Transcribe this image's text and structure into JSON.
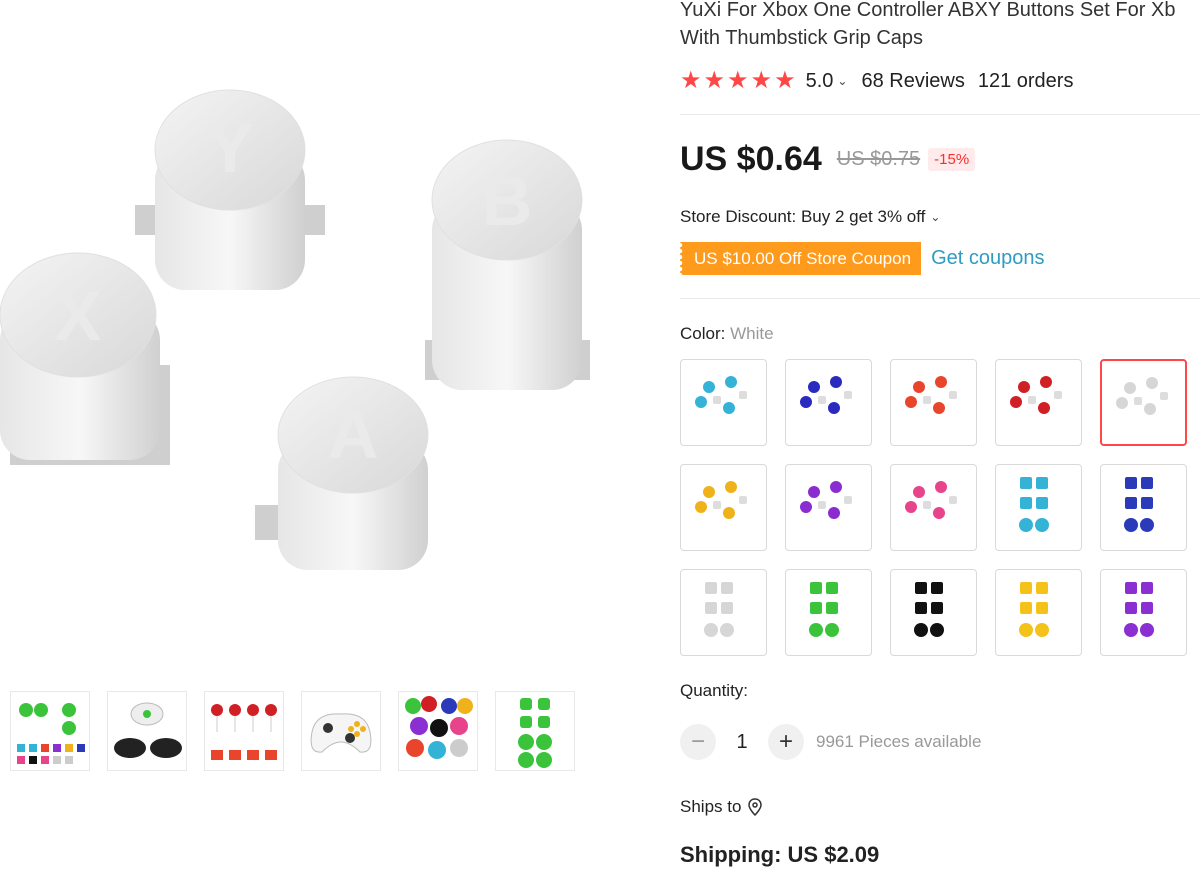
{
  "product": {
    "title_line1": "YuXi For Xbox One Controller ABXY Buttons Set For Xb",
    "title_line2": "With Thumbstick Grip Caps",
    "rating": "5.0",
    "reviews": "68 Reviews",
    "orders": "121 orders",
    "price": "US $0.64",
    "original_price": "US $0.75",
    "discount_badge": "-15%",
    "store_discount": "Store Discount: Buy 2 get 3% off",
    "coupon_label": "US $10.00 Off Store Coupon",
    "get_coupons": "Get coupons",
    "color_label": "Color: ",
    "color_value": "White",
    "quantity_label": "Quantity:",
    "quantity_value": "1",
    "pieces_available": "9961 Pieces available",
    "ships_to": "Ships to",
    "shipping": "Shipping: US $2.09"
  },
  "main_image": {
    "letters": [
      "Y",
      "B",
      "X",
      "A"
    ],
    "color": "#d9d9d9"
  },
  "thumbnails": [
    {
      "name": "multi-color-set"
    },
    {
      "name": "controllers-white-black"
    },
    {
      "name": "red-buttons-labeled"
    },
    {
      "name": "white-controller"
    },
    {
      "name": "colorful-caps-bag"
    },
    {
      "name": "green-set"
    }
  ],
  "swatches": [
    {
      "color": "#34b3d6",
      "layout": "abxy"
    },
    {
      "color": "#2a2abf",
      "layout": "abxy"
    },
    {
      "color": "#e8452c",
      "layout": "abxy"
    },
    {
      "color": "#d11f26",
      "layout": "abxy"
    },
    {
      "color": "#d6d6d6",
      "layout": "abxy",
      "selected": true
    },
    {
      "color": "#f0b21a",
      "layout": "abxy"
    },
    {
      "color": "#8b2cd1",
      "layout": "abxy"
    },
    {
      "color": "#e8448c",
      "layout": "abxy"
    },
    {
      "color": "#34b3d6",
      "layout": "full"
    },
    {
      "color": "#2a3ab8",
      "layout": "full"
    },
    {
      "color": "#d6d6d6",
      "layout": "full"
    },
    {
      "color": "#3bc43b",
      "layout": "full"
    },
    {
      "color": "#111111",
      "layout": "full"
    },
    {
      "color": "#f5c21a",
      "layout": "full"
    },
    {
      "color": "#8a2fd1",
      "layout": "full"
    }
  ],
  "colors": {
    "accent": "#ff4747",
    "coupon": "#fe9a1c",
    "link": "#2e9cc3"
  },
  "icons": {
    "star": "star-icon",
    "location": "location-pin-icon"
  }
}
